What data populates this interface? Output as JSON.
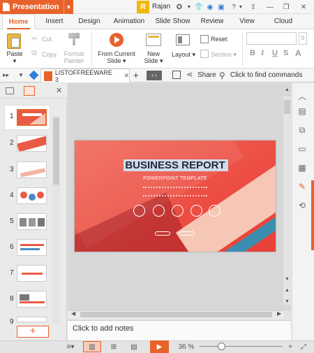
{
  "app": {
    "name": "Presentation",
    "user": "Rajan",
    "avatar_letter": "R",
    "accent": "#e8632c"
  },
  "title_icons": [
    "star-skin-icon",
    "bell-icon",
    "chat-icon",
    "help-icon",
    "share-up-icon",
    "minimize-icon",
    "restore-icon",
    "close-icon"
  ],
  "tabs": [
    {
      "label": "Home",
      "active": true
    },
    {
      "label": "Insert"
    },
    {
      "label": "Design"
    },
    {
      "label": "Animation"
    },
    {
      "label": "Slide Show"
    },
    {
      "label": "Review"
    },
    {
      "label": "View"
    },
    {
      "label": "Cloud"
    }
  ],
  "ribbon": {
    "paste": "Paste",
    "cut": "Cut",
    "copy": "Copy",
    "format_painter_1": "Format",
    "format_painter_2": "Painter",
    "from_current_1": "From Current",
    "from_current_2": "Slide",
    "new_slide_1": "New",
    "new_slide_2": "Slide",
    "layout": "Layout",
    "reset": "Reset",
    "section": "Section",
    "font_size": "0"
  },
  "docbar": {
    "doc_name": "LISTOFFREEWARE 3",
    "share": "Share",
    "find": "Click to find commands"
  },
  "slide": {
    "title": "BUSINESS REPORT",
    "subtitle": "POWERPOINT TEMPLATE"
  },
  "thumb_numbers": [
    "1",
    "2",
    "3",
    "4",
    "5",
    "6",
    "7",
    "8",
    "9"
  ],
  "notes_placeholder": "Click to add notes",
  "status": {
    "zoom": "36 %"
  }
}
